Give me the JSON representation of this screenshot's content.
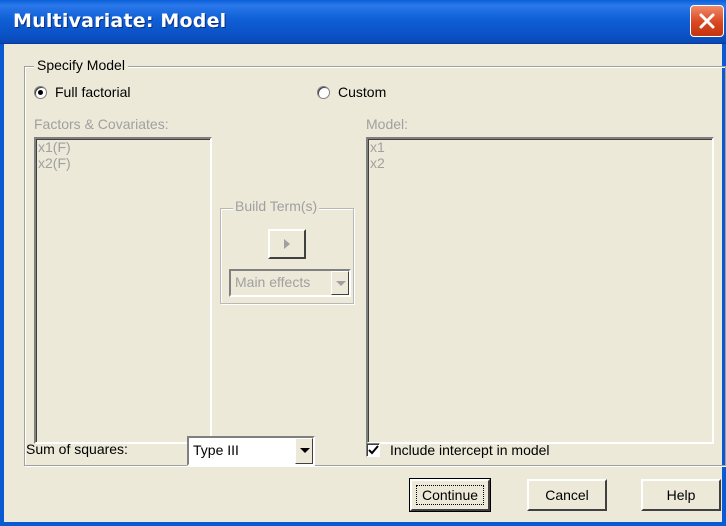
{
  "window": {
    "title": "Multivariate: Model"
  },
  "specify_model": {
    "legend": "Specify Model",
    "full_factorial_label": "Full factorial",
    "custom_label": "Custom",
    "selected": "Full factorial"
  },
  "factors": {
    "label": "Factors & Covariates:",
    "items": [
      "x1(F)",
      "x2(F)"
    ]
  },
  "model": {
    "label": "Model:",
    "items": [
      "x1",
      "x2"
    ]
  },
  "build_terms": {
    "legend": "Build Term(s)",
    "type_value": "Main effects"
  },
  "sum_of_squares": {
    "label": "Sum of squares:",
    "value": "Type III"
  },
  "intercept": {
    "label": "Include intercept in model",
    "checked": true
  },
  "buttons": {
    "continue": "Continue",
    "cancel": "Cancel",
    "help": "Help"
  },
  "colors": {
    "titlebar": "#0b52c6",
    "dialog_bg": "#ece9d8",
    "disabled_text": "#a0a0a0",
    "close_button": "#d9461f"
  }
}
